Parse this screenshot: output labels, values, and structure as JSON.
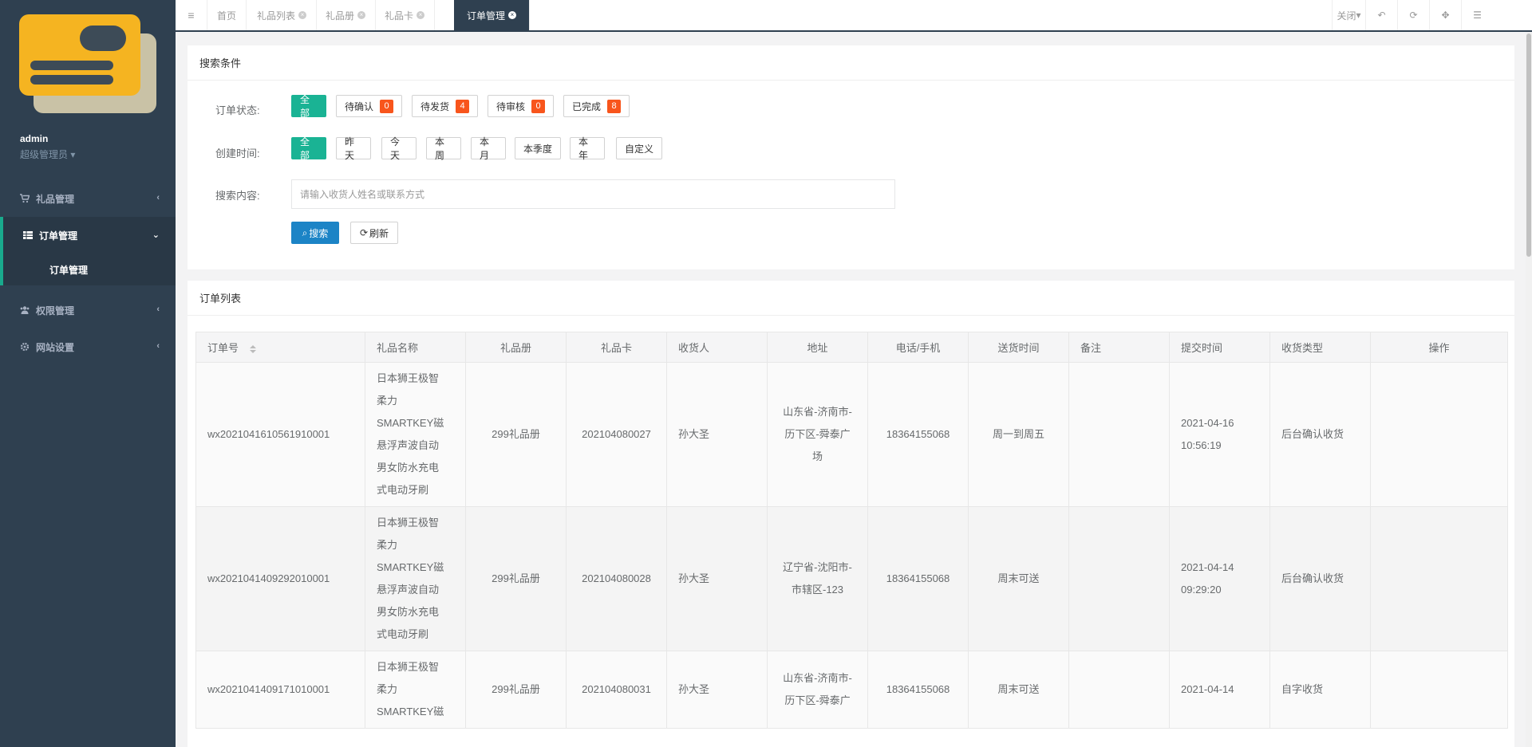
{
  "sidebar": {
    "user_name": "admin",
    "user_role": "超级管理员",
    "items": [
      {
        "label": "礼品管理",
        "icon": "cart-icon"
      },
      {
        "label": "订单管理",
        "icon": "table-icon",
        "active": true
      },
      {
        "label": "权限管理",
        "icon": "users-icon"
      },
      {
        "label": "网站设置",
        "icon": "gear-icon"
      }
    ],
    "sub_items": [
      {
        "label": "订单管理"
      }
    ]
  },
  "topbar": {
    "menu_icon": "hamburger-icon",
    "tabs": [
      {
        "label": "首页",
        "closable": false
      },
      {
        "label": "礼品列表",
        "closable": true
      },
      {
        "label": "礼品册",
        "closable": true
      },
      {
        "label": "礼品卡",
        "closable": true
      },
      {
        "label": "订单管理",
        "closable": true,
        "active": true
      }
    ],
    "close_label": "关闭",
    "right_icons": [
      "back-icon",
      "refresh-icon",
      "fullscreen-icon",
      "menu-toggle-icon"
    ]
  },
  "search": {
    "title": "搜索条件",
    "status_label": "订单状态:",
    "status_options": [
      {
        "label": "全部",
        "active": true
      },
      {
        "label": "待确认",
        "count": "0"
      },
      {
        "label": "待发货",
        "count": "4"
      },
      {
        "label": "待审核",
        "count": "0"
      },
      {
        "label": "已完成",
        "count": "8"
      }
    ],
    "time_label": "创建时间:",
    "time_options": [
      {
        "label": "全部",
        "active": true
      },
      {
        "label": "昨天"
      },
      {
        "label": "今天"
      },
      {
        "label": "本周"
      },
      {
        "label": "本月"
      },
      {
        "label": "本季度"
      },
      {
        "label": "本年"
      },
      {
        "label": "自定义"
      }
    ],
    "content_label": "搜索内容:",
    "placeholder": "请输入收货人姓名或联系方式",
    "search_button": "搜索",
    "refresh_button": "刷新"
  },
  "orders": {
    "title": "订单列表",
    "columns": [
      "订单号",
      "礼品名称",
      "礼品册",
      "礼品卡",
      "收货人",
      "地址",
      "电话/手机",
      "送货时间",
      "备注",
      "提交时间",
      "收货类型",
      "操作"
    ],
    "rows": [
      {
        "order_no": "wx2021041610561910001",
        "gift_name": [
          "日本狮王极智",
          "柔力",
          "SMARTKEY磁",
          "悬浮声波自动",
          "男女防水充电",
          "式电动牙刷"
        ],
        "gift_book": "299礼品册",
        "gift_card": "202104080027",
        "receiver": "孙大圣",
        "address": [
          "山东省-济南市-",
          "历下区-舜泰广",
          "场"
        ],
        "phone": "18364155068",
        "delivery_time": "周一到周五",
        "remark": "",
        "submit_time": [
          "2021-04-16",
          "10:56:19"
        ],
        "receipt_type": "后台确认收货",
        "action": ""
      },
      {
        "order_no": "wx2021041409292010001",
        "gift_name": [
          "日本狮王极智",
          "柔力",
          "SMARTKEY磁",
          "悬浮声波自动",
          "男女防水充电",
          "式电动牙刷"
        ],
        "gift_book": "299礼品册",
        "gift_card": "202104080028",
        "receiver": "孙大圣",
        "address": [
          "辽宁省-沈阳市-",
          "市辖区-123"
        ],
        "phone": "18364155068",
        "delivery_time": "周末可送",
        "remark": "",
        "submit_time": [
          "2021-04-14",
          "09:29:20"
        ],
        "receipt_type": "后台确认收货",
        "action": ""
      },
      {
        "order_no": "wx2021041409171010001",
        "gift_name": [
          "日本狮王极智",
          "柔力",
          "SMARTKEY磁"
        ],
        "gift_book": "299礼品册",
        "gift_card": "202104080031",
        "receiver": "孙大圣",
        "address": [
          "山东省-济南市-",
          "历下区-舜泰广"
        ],
        "phone": "18364155068",
        "delivery_time": "周末可送",
        "remark": "",
        "submit_time": [
          "2021-04-14"
        ],
        "receipt_type": "自字收货",
        "action": ""
      }
    ]
  },
  "colors": {
    "sidebar_bg": "#2f4050",
    "primary": "#1ab394",
    "badge": "#f8551c",
    "search_button": "#1c84c6"
  }
}
